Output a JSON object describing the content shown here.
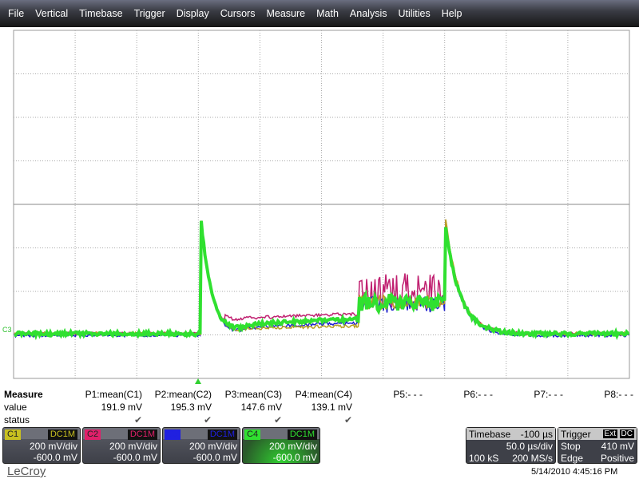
{
  "menu": [
    "File",
    "Vertical",
    "Timebase",
    "Trigger",
    "Display",
    "Cursors",
    "Measure",
    "Math",
    "Analysis",
    "Utilities",
    "Help"
  ],
  "measure": {
    "title": "Measure",
    "row_value": "value",
    "row_status": "status",
    "params": [
      {
        "label": "P1:mean(C1)",
        "value": "191.9 mV",
        "status": "✔"
      },
      {
        "label": "P2:mean(C2)",
        "value": "195.3 mV",
        "status": "✔"
      },
      {
        "label": "P3:mean(C3)",
        "value": "147.6 mV",
        "status": "✔"
      },
      {
        "label": "P4:mean(C4)",
        "value": "139.1 mV",
        "status": "✔"
      },
      {
        "label": "P5:- - -",
        "value": "",
        "status": ""
      },
      {
        "label": "P6:- - -",
        "value": "",
        "status": ""
      },
      {
        "label": "P7:- - -",
        "value": "",
        "status": ""
      },
      {
        "label": "P8:- - -",
        "value": "",
        "status": ""
      }
    ]
  },
  "channels": [
    {
      "name": "C1",
      "coupling": "DC1M",
      "scale": "200 mV/div",
      "offset": "-600.0 mV",
      "color": "#c8c020"
    },
    {
      "name": "C2",
      "coupling": "DC1M",
      "scale": "200 mV/div",
      "offset": "-600.0 mV",
      "color": "#e0206a"
    },
    {
      "name": "C3",
      "coupling": "DC1M",
      "scale": "200 mV/div",
      "offset": "-600.0 mV",
      "color": "#2020e0"
    },
    {
      "name": "C4",
      "coupling": "DC1M",
      "scale": "200 mV/div",
      "offset": "-600.0 mV",
      "color": "#30e030"
    }
  ],
  "timebase": {
    "label": "Timebase",
    "delay": "-100 µs",
    "scale": "50.0 µs/div",
    "samples": "100 kS",
    "rate": "200 MS/s"
  },
  "trigger": {
    "label": "Trigger",
    "source": "Ext",
    "coupling": "DC",
    "mode": "Stop",
    "level": "410 mV",
    "type": "Edge",
    "slope": "Positive"
  },
  "ground_marker": "C3",
  "brand": "LeCroy",
  "timestamp": "5/14/2010 4:45:16 PM"
}
